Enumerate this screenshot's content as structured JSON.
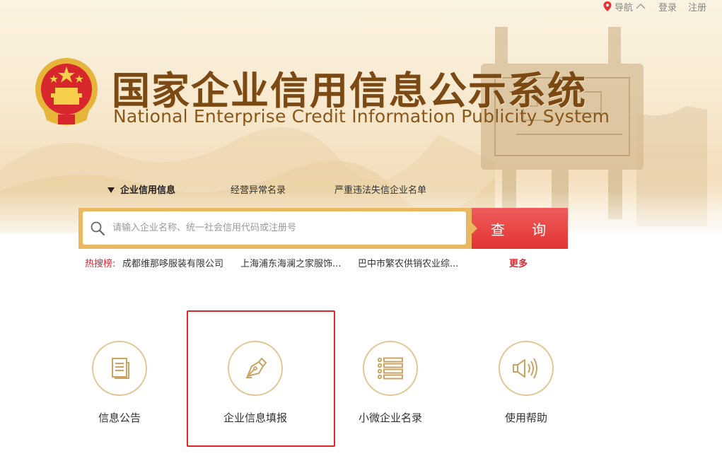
{
  "topbar": {
    "nav_label": "导航",
    "login_label": "登录",
    "register_label": "注册"
  },
  "header": {
    "title_cn": "国家企业信用信息公示系统",
    "title_en": "National Enterprise Credit Information Publicity System"
  },
  "tabs": [
    {
      "label": "企业信用信息",
      "active": true
    },
    {
      "label": "经营异常名录",
      "active": false
    },
    {
      "label": "严重违法失信企业名单",
      "active": false
    }
  ],
  "search": {
    "placeholder": "请输入企业名称、统一社会信用代码或注册号",
    "button_label": "查 询"
  },
  "hot_search": {
    "label": "热搜榜:",
    "items": [
      "成都维那哆服装有限公司",
      "上海浦东海澜之家服饰...",
      "巴中市繁农供销农业综..."
    ],
    "more_label": "更多"
  },
  "features": [
    {
      "label": "信息公告",
      "icon": "document-icon"
    },
    {
      "label": "企业信息填报",
      "icon": "pen-nib-icon"
    },
    {
      "label": "小微企业名录",
      "icon": "list-icon"
    },
    {
      "label": "使用帮助",
      "icon": "speaker-icon"
    }
  ],
  "colors": {
    "brand_brown": "#7b4a14",
    "gold": "#e9b860",
    "search_red": "#e23434",
    "hot_red": "#d9262c",
    "circle_border": "#e0c793",
    "highlight_red": "#e2262a"
  }
}
